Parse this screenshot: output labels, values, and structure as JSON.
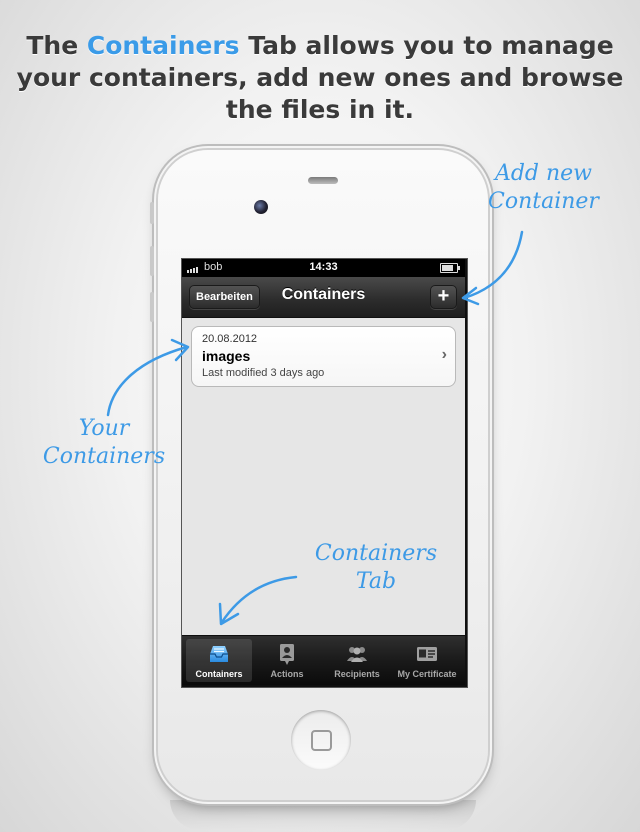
{
  "headline": {
    "prefix": "The ",
    "highlight": "Containers",
    "line1_rest": " Tab allows you to manage",
    "line2": "your containers, add new ones and browse",
    "line3": "the files in it."
  },
  "status_bar": {
    "carrier": "bob",
    "time": "14:33"
  },
  "nav_bar": {
    "edit_label": "Bearbeiten",
    "title": "Containers",
    "add_label": "+"
  },
  "containers": [
    {
      "date": "20.08.2012",
      "name": "images",
      "modified": "Last modified 3 days ago"
    }
  ],
  "tabs": [
    {
      "label": "Containers",
      "icon": "inbox-tray-icon",
      "active": true
    },
    {
      "label": "Actions",
      "icon": "person-badge-icon",
      "active": false
    },
    {
      "label": "Recipients",
      "icon": "people-group-icon",
      "active": false
    },
    {
      "label": "My Certificate",
      "icon": "id-card-icon",
      "active": false
    }
  ],
  "annotations": {
    "add_new_line1": "Add new",
    "add_new_line2": "Container",
    "your_line1": "Your",
    "your_line2": "Containers",
    "tab_line1": "Containers",
    "tab_line2": "Tab"
  },
  "colors": {
    "accent": "#3a9be8",
    "annotation": "#3d9ae6"
  }
}
